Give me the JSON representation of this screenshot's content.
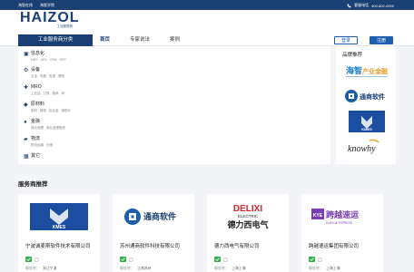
{
  "topbar": {
    "links": [
      "海智在线",
      "海智学院"
    ],
    "hotline_label": "客服电话",
    "hotline_number": "400-602-0000"
  },
  "header": {
    "logo_text": "HAIZOL",
    "logo_sub": "工业服务商"
  },
  "nav": {
    "category_tab": "工业服务商分类",
    "items": [
      "首页",
      "专家说法",
      "案例"
    ],
    "active": "首页",
    "login": "登录",
    "register": "注册"
  },
  "categories": [
    {
      "title": "信息化",
      "subs": [
        "MES",
        "APS",
        "CRM",
        "ERP"
      ]
    },
    {
      "title": "设备",
      "subs": [
        "五金",
        "电器",
        "电源",
        "照明"
      ]
    },
    {
      "title": "MRO",
      "subs": [
        "工业品",
        "刀具",
        "轴承",
        "阀"
      ]
    },
    {
      "title": "原材料",
      "subs": [
        "钢材",
        "铸铁",
        "铝合金",
        "钢筋头"
      ]
    },
    {
      "title": "金融",
      "subs": [
        "商业保理",
        "商业保理融资"
      ]
    },
    {
      "title": "物流",
      "subs": [
        "物流运输",
        "仓储"
      ]
    },
    {
      "title": "其它",
      "subs": []
    }
  ],
  "brand_panel": {
    "title": "品牌推荐",
    "brands": [
      "产业金融",
      "通商软件",
      "KMES",
      "knowhy"
    ]
  },
  "providers": {
    "title": "服务商推荐",
    "location_label": "服务地：",
    "items": [
      {
        "logo_text": "KMES",
        "name": "宁波诚麦斯软件技术有限公司",
        "location": "浙江宁波"
      },
      {
        "logo_text": "通商软件",
        "name": "苏州通商软件科技有限公司",
        "location": "江苏苏州"
      },
      {
        "logo_text": "DELIXI",
        "logo_sub": "ELECTRIC",
        "logo_cn": "德力西电气",
        "name": "德力西电气有限公司",
        "location": "上海上海"
      },
      {
        "logo_text": "KYE",
        "logo_cn": "跨越速运",
        "logo_en": "KUAYUE EXPRESS",
        "name": "跨越速运集团有限公司",
        "location": "上海上海"
      }
    ]
  },
  "colors": {
    "primary": "#1a3f73",
    "accent": "#1f5fb0",
    "verified": "#36b24a",
    "delixi_red": "#d7262c"
  }
}
